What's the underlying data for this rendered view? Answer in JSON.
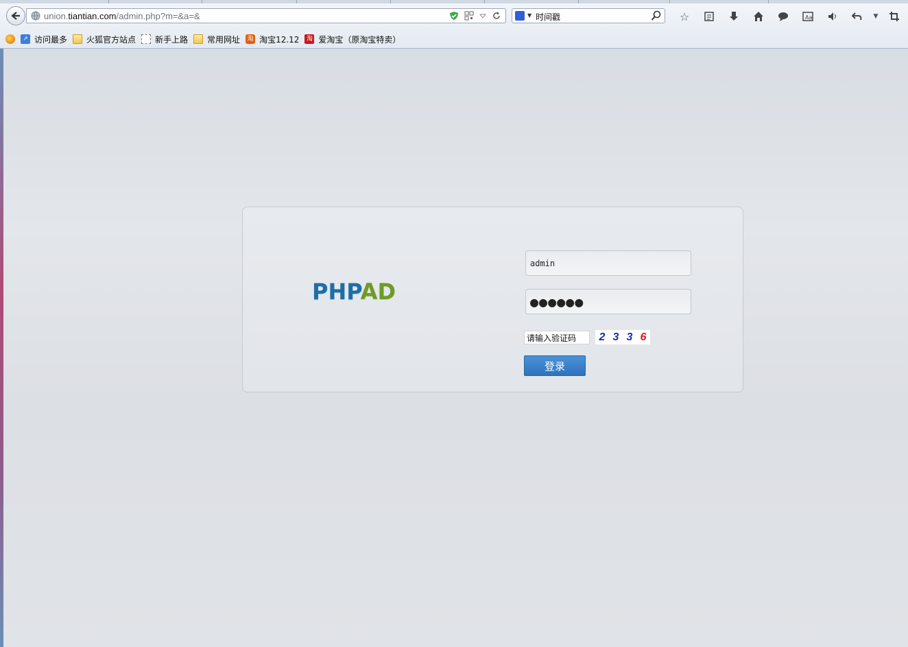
{
  "browser": {
    "url_prefix": "union.",
    "url_domain": "tiantian.com",
    "url_path": "/admin.php?m=&a=&",
    "search_text": "时间戳"
  },
  "bookmarks": [
    {
      "label": "访问最多",
      "icon": "visit-icon"
    },
    {
      "label": "火狐官方站点",
      "icon": "folder-icon"
    },
    {
      "label": "新手上路",
      "icon": "page-icon"
    },
    {
      "label": "常用网址",
      "icon": "folder-icon"
    },
    {
      "label": "淘宝12.12",
      "icon": "taobao-icon"
    },
    {
      "label": "爱淘宝（原淘宝特卖）",
      "icon": "aitaobao-icon"
    }
  ],
  "login": {
    "logo_php": "PHP",
    "logo_ad": "AD",
    "username": "admin",
    "password_mask": "●●●●●●",
    "captcha_placeholder": "请输入验证码",
    "captcha_chars": [
      {
        "char": "2",
        "color": "#1a2ea8"
      },
      {
        "char": "3",
        "color": "#1a2ea8"
      },
      {
        "char": "3",
        "color": "#1a2ea8"
      },
      {
        "char": "6",
        "color": "#d41a1a"
      }
    ],
    "submit_label": "登录"
  }
}
